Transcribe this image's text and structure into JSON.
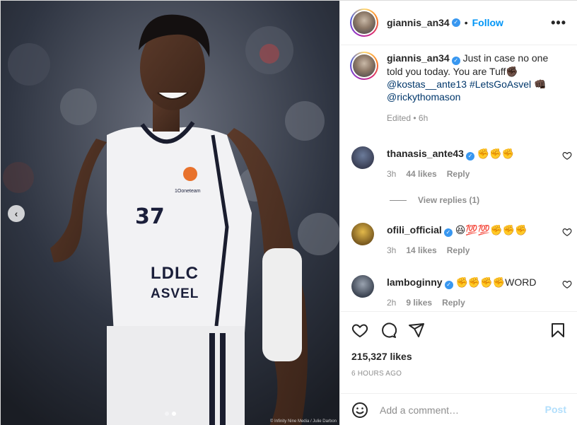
{
  "colors": {
    "accent": "#0095f6",
    "verified": "#3897f0",
    "muted": "#8e8e8e",
    "post_disabled": "#b2dffc"
  },
  "photo": {
    "jersey_number": "37",
    "jersey_sponsor_line1": "LDLC",
    "jersey_sponsor_line2": "ASVEL",
    "jersey_brand": "1Ooneteam",
    "credit": "© Infinity Nine Media / Julie Darbon",
    "carousel_index": 2,
    "carousel_total": 2
  },
  "header": {
    "username": "giannis_an34",
    "separator": "•",
    "follow_label": "Follow",
    "more_label": "•••"
  },
  "caption": {
    "username": "giannis_an34",
    "text": "Just in case no one told you today. You are Tuff✊🏿",
    "mention1": "@kostas__ante13",
    "hashtag": "#LetsGoAsvel",
    "emoji_after_hashtag": "👊🏿",
    "mention2": "@rickythomason",
    "edited": "Edited",
    "edited_sep": "•",
    "edited_time": "6h"
  },
  "comments": [
    {
      "username": "thanasis_ante43",
      "text": "✊✊✊",
      "time": "3h",
      "likes": "44 likes",
      "reply": "Reply"
    },
    {
      "username": "ofili_official",
      "text": "😆💯💯✊✊✊",
      "time": "3h",
      "likes": "14 likes",
      "reply": "Reply"
    },
    {
      "username": "lamboginny",
      "text": "✊✊✊✊WORD",
      "time": "2h",
      "likes": "9 likes",
      "reply": "Reply"
    }
  ],
  "view_replies": "View replies (1)",
  "actions": {
    "likes": "215,327 likes",
    "time_ago": "6 HOURS AGO"
  },
  "add_comment": {
    "placeholder": "Add a comment…",
    "post_label": "Post"
  }
}
